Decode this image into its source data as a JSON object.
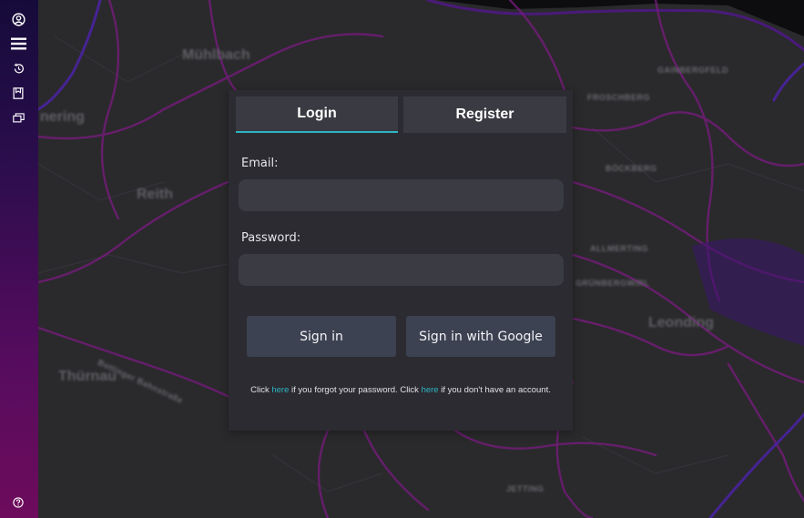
{
  "map": {
    "labels": [
      "Mühlbach",
      "nering",
      "Reith",
      "Thürnau",
      "Leonding",
      "GAINBERGFELD",
      "FROSCHBERG",
      "BÖCKBERG",
      "ALLMERTING",
      "GRÜNBERGWIRL",
      "JETTING",
      "Bottinger Bahnstraße"
    ]
  },
  "sidebar": {
    "icons": [
      "account-icon",
      "menu-icon",
      "history-icon",
      "bookmark-icon",
      "layers-icon"
    ],
    "help_icon": "help-icon"
  },
  "auth": {
    "tabs": {
      "login": "Login",
      "register": "Register"
    },
    "email_label": "Email:",
    "email_value": "",
    "password_label": "Password:",
    "password_value": "",
    "signin_label": "Sign in",
    "google_label": "Sign in with Google",
    "help": {
      "part1": "Click ",
      "link1": "here",
      "part2": " if you forgot your password. Click ",
      "link2": "here",
      "part3": " if you don't have an account."
    },
    "accent_color": "#2fb4c2"
  }
}
